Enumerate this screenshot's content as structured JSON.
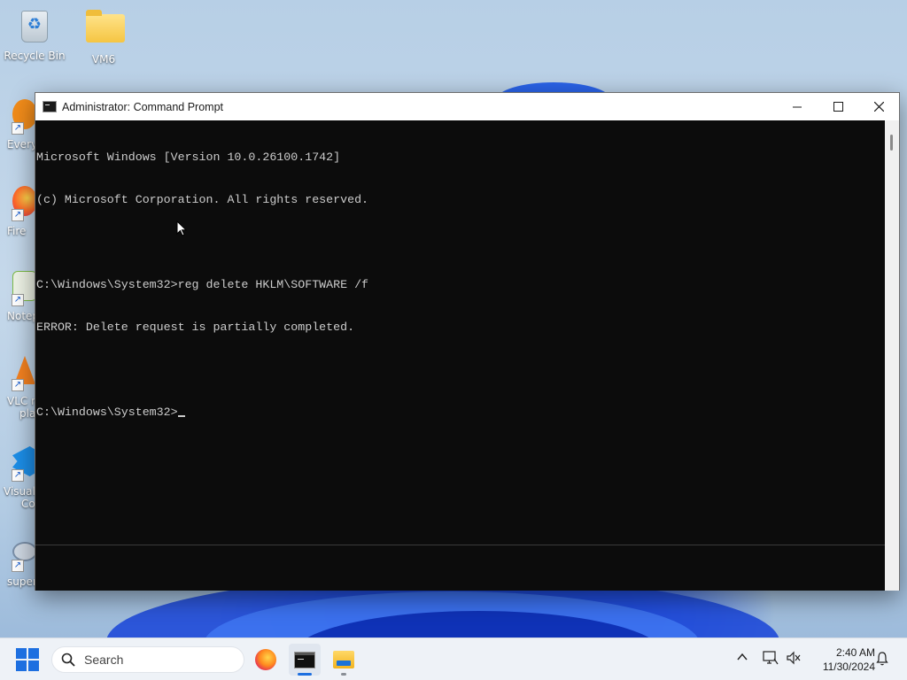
{
  "desktop": {
    "icons": [
      {
        "label": "Recycle Bin",
        "icon": "recycle-bin-icon"
      },
      {
        "label": "VM6",
        "icon": "folder-icon"
      }
    ],
    "partial_icons": [
      {
        "label": "Every",
        "icon": "everything-search-icon",
        "color": "#f28c1a"
      },
      {
        "label": "Fire",
        "icon": "firefox-icon",
        "color": "#ff6a2a"
      },
      {
        "label": "Notep",
        "icon": "notepad-plus-plus-icon",
        "color": "#7dbb4a"
      },
      {
        "label": "VLC m",
        "label2": "pla",
        "icon": "vlc-icon",
        "color": "#f58220"
      },
      {
        "label": "Visual",
        "label2": "Co",
        "icon": "vscode-icon",
        "color": "#1c8ee8"
      },
      {
        "label": "super",
        "icon": "superdisk-icon",
        "color": "#7a8fa8"
      }
    ]
  },
  "window": {
    "title": "Administrator: Command Prompt",
    "minimize_glyph": "—",
    "maximize_glyph": "☐",
    "close_glyph": "✕",
    "console_lines": [
      "Microsoft Windows [Version 10.0.26100.1742]",
      "(c) Microsoft Corporation. All rights reserved.",
      "",
      "C:\\Windows\\System32>reg delete HKLM\\SOFTWARE /f",
      "ERROR: Delete request is partially completed.",
      ""
    ],
    "prompt": "C:\\Windows\\System32>"
  },
  "taskbar": {
    "search_placeholder": "Search",
    "apps": [
      {
        "name": "Firefox",
        "icon": "firefox-icon"
      },
      {
        "name": "Command Prompt",
        "icon": "command-prompt-icon"
      },
      {
        "name": "File Explorer",
        "icon": "file-explorer-icon"
      }
    ],
    "clock_time": "2:40 AM",
    "clock_date": "11/30/2024",
    "accent_color": "#1d6fe0"
  }
}
